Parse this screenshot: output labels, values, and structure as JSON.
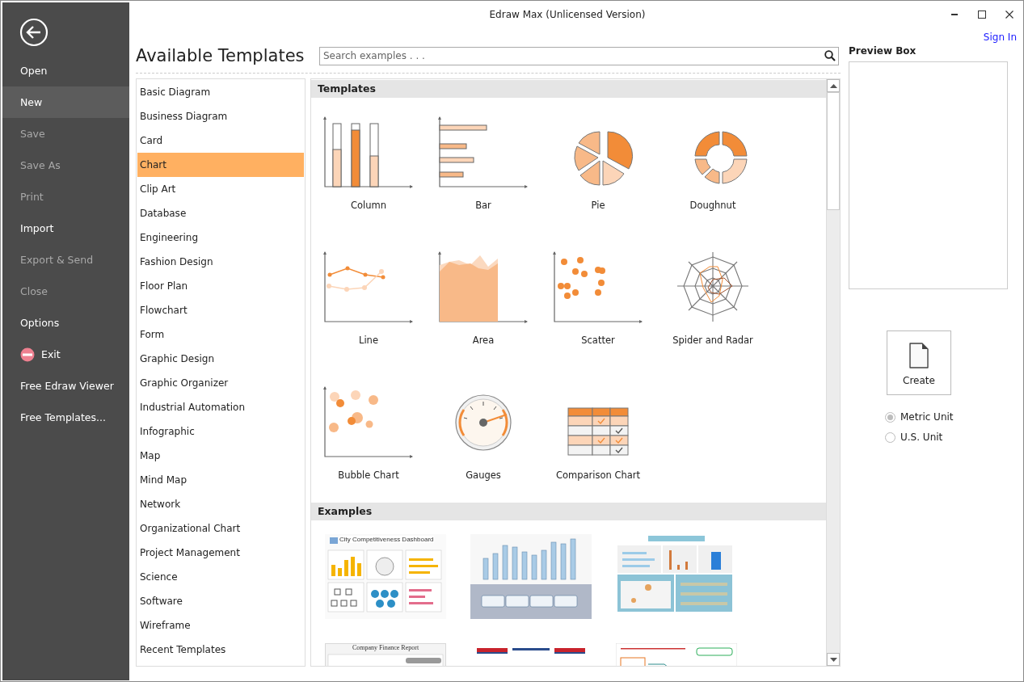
{
  "window": {
    "title": "Edraw Max (Unlicensed Version)",
    "sign_in": "Sign In"
  },
  "backstage": {
    "items": [
      {
        "label": "Open",
        "kind": "text",
        "selected": false,
        "disabled": false
      },
      {
        "label": "New",
        "kind": "text",
        "selected": true,
        "disabled": false
      },
      {
        "label": "Save",
        "kind": "text",
        "selected": false,
        "disabled": true
      },
      {
        "label": "Save As",
        "kind": "text",
        "selected": false,
        "disabled": true
      },
      {
        "label": "Print",
        "kind": "text",
        "selected": false,
        "disabled": true
      },
      {
        "label": "Import",
        "kind": "text",
        "selected": false,
        "disabled": false
      },
      {
        "label": "Export & Send",
        "kind": "text",
        "selected": false,
        "disabled": true
      },
      {
        "label": "Close",
        "kind": "text",
        "selected": false,
        "disabled": true
      },
      {
        "label": "Options",
        "kind": "text",
        "selected": false,
        "disabled": false
      },
      {
        "label": "Exit",
        "kind": "exit",
        "selected": false,
        "disabled": false
      },
      {
        "label": "Free Edraw Viewer",
        "kind": "text",
        "selected": false,
        "disabled": false
      },
      {
        "label": "Free Templates...",
        "kind": "text",
        "selected": false,
        "disabled": false
      }
    ]
  },
  "heading": "Available Templates",
  "search": {
    "placeholder": "Search examples . . ."
  },
  "categories": [
    {
      "label": "Basic Diagram",
      "selected": false
    },
    {
      "label": "Business Diagram",
      "selected": false
    },
    {
      "label": "Card",
      "selected": false
    },
    {
      "label": "Chart",
      "selected": true
    },
    {
      "label": "Clip Art",
      "selected": false
    },
    {
      "label": "Database",
      "selected": false
    },
    {
      "label": "Engineering",
      "selected": false
    },
    {
      "label": "Fashion Design",
      "selected": false
    },
    {
      "label": "Floor Plan",
      "selected": false
    },
    {
      "label": "Flowchart",
      "selected": false
    },
    {
      "label": "Form",
      "selected": false
    },
    {
      "label": "Graphic Design",
      "selected": false
    },
    {
      "label": "Graphic Organizer",
      "selected": false
    },
    {
      "label": "Industrial Automation",
      "selected": false
    },
    {
      "label": "Infographic",
      "selected": false
    },
    {
      "label": "Map",
      "selected": false
    },
    {
      "label": "Mind Map",
      "selected": false
    },
    {
      "label": "Network",
      "selected": false
    },
    {
      "label": "Organizational Chart",
      "selected": false
    },
    {
      "label": "Project Management",
      "selected": false
    },
    {
      "label": "Science",
      "selected": false
    },
    {
      "label": "Software",
      "selected": false
    },
    {
      "label": "Wireframe",
      "selected": false
    },
    {
      "label": "Recent Templates",
      "selected": false
    }
  ],
  "templates": {
    "title": "Templates",
    "items": [
      {
        "label": "Column",
        "kind": "column"
      },
      {
        "label": "Bar",
        "kind": "bar"
      },
      {
        "label": "Pie",
        "kind": "pie"
      },
      {
        "label": "Doughnut",
        "kind": "doughnut"
      },
      {
        "label": "Line",
        "kind": "line"
      },
      {
        "label": "Area",
        "kind": "area"
      },
      {
        "label": "Scatter",
        "kind": "scatter"
      },
      {
        "label": "Spider and Radar",
        "kind": "radar"
      },
      {
        "label": "Bubble Chart",
        "kind": "bubble"
      },
      {
        "label": "Gauges",
        "kind": "gauge"
      },
      {
        "label": "Comparison Chart",
        "kind": "comparison"
      }
    ]
  },
  "examples": {
    "title": "Examples",
    "items": [
      {
        "kind": "dashboard",
        "title": "City Competitiveness Dashboard"
      },
      {
        "kind": "columns"
      },
      {
        "kind": "infographic"
      },
      {
        "kind": "report",
        "title": "Company Finance Report"
      },
      {
        "kind": "banner"
      },
      {
        "kind": "mindmap"
      }
    ]
  },
  "preview": {
    "title": "Preview Box",
    "create": "Create",
    "units": [
      {
        "label": "Metric Unit",
        "selected": true
      },
      {
        "label": "U.S. Unit",
        "selected": false
      }
    ]
  }
}
